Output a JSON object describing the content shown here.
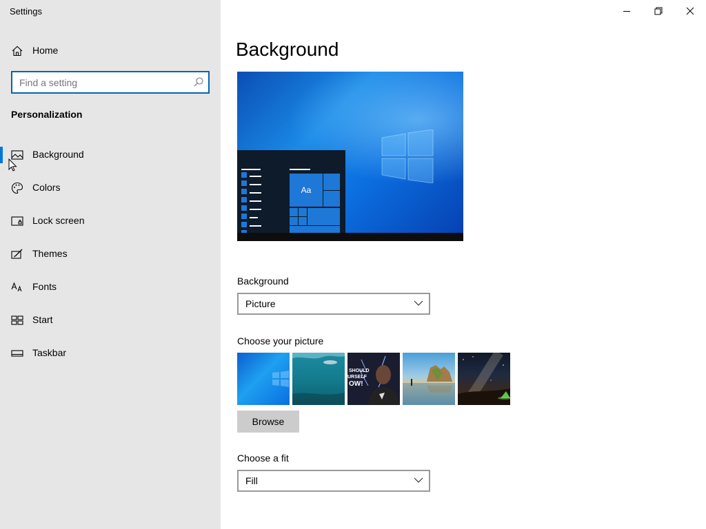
{
  "window": {
    "title": "Settings",
    "controls": {
      "minimize": "minimize",
      "restore": "restore",
      "close": "close"
    }
  },
  "sidebar": {
    "home_label": "Home",
    "search": {
      "placeholder": "Find a setting",
      "value": ""
    },
    "section_heading": "Personalization",
    "items": [
      {
        "label": "Background",
        "icon": "picture-icon",
        "selected": true
      },
      {
        "label": "Colors",
        "icon": "palette-icon",
        "selected": false
      },
      {
        "label": "Lock screen",
        "icon": "lock-screen-icon",
        "selected": false
      },
      {
        "label": "Themes",
        "icon": "themes-icon",
        "selected": false
      },
      {
        "label": "Fonts",
        "icon": "fonts-icon",
        "selected": false
      },
      {
        "label": "Start",
        "icon": "start-icon",
        "selected": false
      },
      {
        "label": "Taskbar",
        "icon": "taskbar-icon",
        "selected": false
      }
    ]
  },
  "main": {
    "title": "Background",
    "preview": {
      "tile_text": "Aa"
    },
    "background_field": {
      "label": "Background",
      "value": "Picture"
    },
    "choose_picture": {
      "label": "Choose your picture",
      "thumbnails": [
        {
          "name": "windows-blue",
          "overlay_text": ""
        },
        {
          "name": "underwater-swimmer",
          "overlay_text": ""
        },
        {
          "name": "portrait-poster",
          "overlay_text": "SHOULD\nURSEL\nOW!"
        },
        {
          "name": "beach-rocks",
          "overlay_text": ""
        },
        {
          "name": "night-sky-tent",
          "overlay_text": ""
        }
      ],
      "browse_label": "Browse"
    },
    "fit_field": {
      "label": "Choose a fit",
      "value": "Fill"
    }
  },
  "colors": {
    "accent": "#0078d7",
    "sidebar_bg": "#e6e6e6",
    "button_bg": "#cccccc"
  }
}
